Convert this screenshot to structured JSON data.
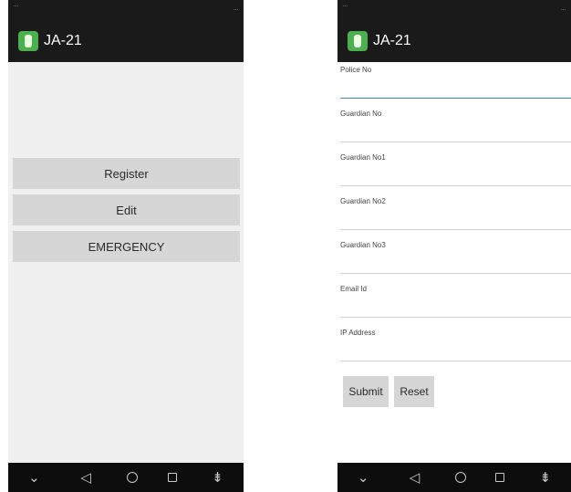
{
  "app": {
    "title": "JA-21"
  },
  "left_screen": {
    "status": {
      "carrier": "...",
      "right": "..."
    },
    "buttons": {
      "register": "Register",
      "edit": "Edit",
      "emergency": "EMERGENCY"
    }
  },
  "right_screen": {
    "status": {
      "carrier": "...",
      "right": "..."
    },
    "fields": [
      {
        "label": "Police No",
        "value": ""
      },
      {
        "label": "Guardian No",
        "value": ""
      },
      {
        "label": "Guardian No1",
        "value": ""
      },
      {
        "label": "Guardian No2",
        "value": ""
      },
      {
        "label": "Guardian No3",
        "value": ""
      },
      {
        "label": "Email Id",
        "value": ""
      },
      {
        "label": "IP Address",
        "value": ""
      }
    ],
    "buttons": {
      "submit": "Submit",
      "reset": "Reset"
    }
  },
  "nav": {
    "back": "◁",
    "home": "○",
    "recents": "□",
    "menu": "⌄",
    "extra": "⇟"
  },
  "colors": {
    "bar": "#1a1a1a",
    "button": "#d6d6d6",
    "accent_underline": "#3a8ea0",
    "app_icon": "#4caf50"
  }
}
